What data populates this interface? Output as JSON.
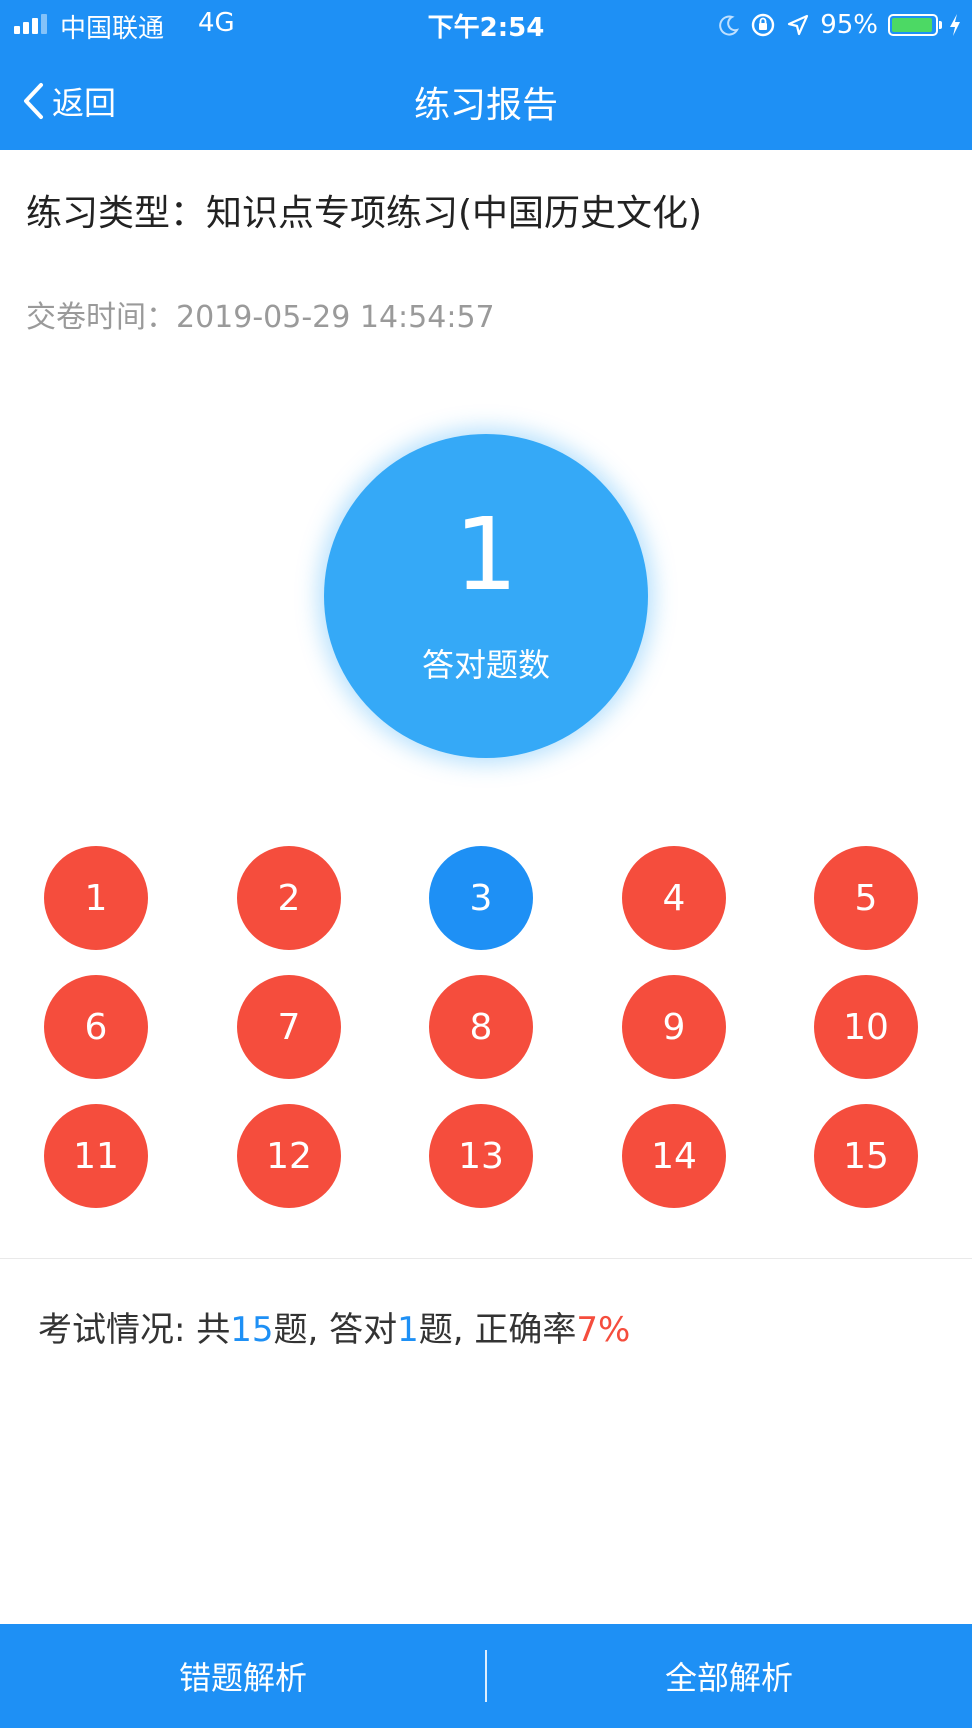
{
  "status_bar": {
    "carrier": "中国联通",
    "network": "4G",
    "time": "下午2:54",
    "battery": "95%",
    "battery_level": 0.95
  },
  "nav": {
    "back_label": "返回",
    "title": "练习报告"
  },
  "info": {
    "practice_type": "练习类型：知识点专项练习(中国历史文化)",
    "submit_time": "交卷时间：2019-05-29 14:54:57"
  },
  "score": {
    "value": "1",
    "label": "答对题数"
  },
  "questions": [
    {
      "n": "1",
      "status": "wrong"
    },
    {
      "n": "2",
      "status": "wrong"
    },
    {
      "n": "3",
      "status": "correct"
    },
    {
      "n": "4",
      "status": "wrong"
    },
    {
      "n": "5",
      "status": "wrong"
    },
    {
      "n": "6",
      "status": "wrong"
    },
    {
      "n": "7",
      "status": "wrong"
    },
    {
      "n": "8",
      "status": "wrong"
    },
    {
      "n": "9",
      "status": "wrong"
    },
    {
      "n": "10",
      "status": "wrong"
    },
    {
      "n": "11",
      "status": "wrong"
    },
    {
      "n": "12",
      "status": "wrong"
    },
    {
      "n": "13",
      "status": "wrong"
    },
    {
      "n": "14",
      "status": "wrong"
    },
    {
      "n": "15",
      "status": "wrong"
    }
  ],
  "summary": {
    "prefix": "考试情况: 共",
    "total": "15",
    "mid1": "题, 答对",
    "correct": "1",
    "mid2": "题, 正确率",
    "rate": "7%"
  },
  "bottom": {
    "wrong_analysis": "错题解析",
    "all_analysis": "全部解析"
  },
  "colors": {
    "primary": "#1E90F5",
    "score_circle": "#35A9F7",
    "wrong": "#F54D3D",
    "correct": "#1E90F5",
    "rate": "#F54D3D"
  }
}
